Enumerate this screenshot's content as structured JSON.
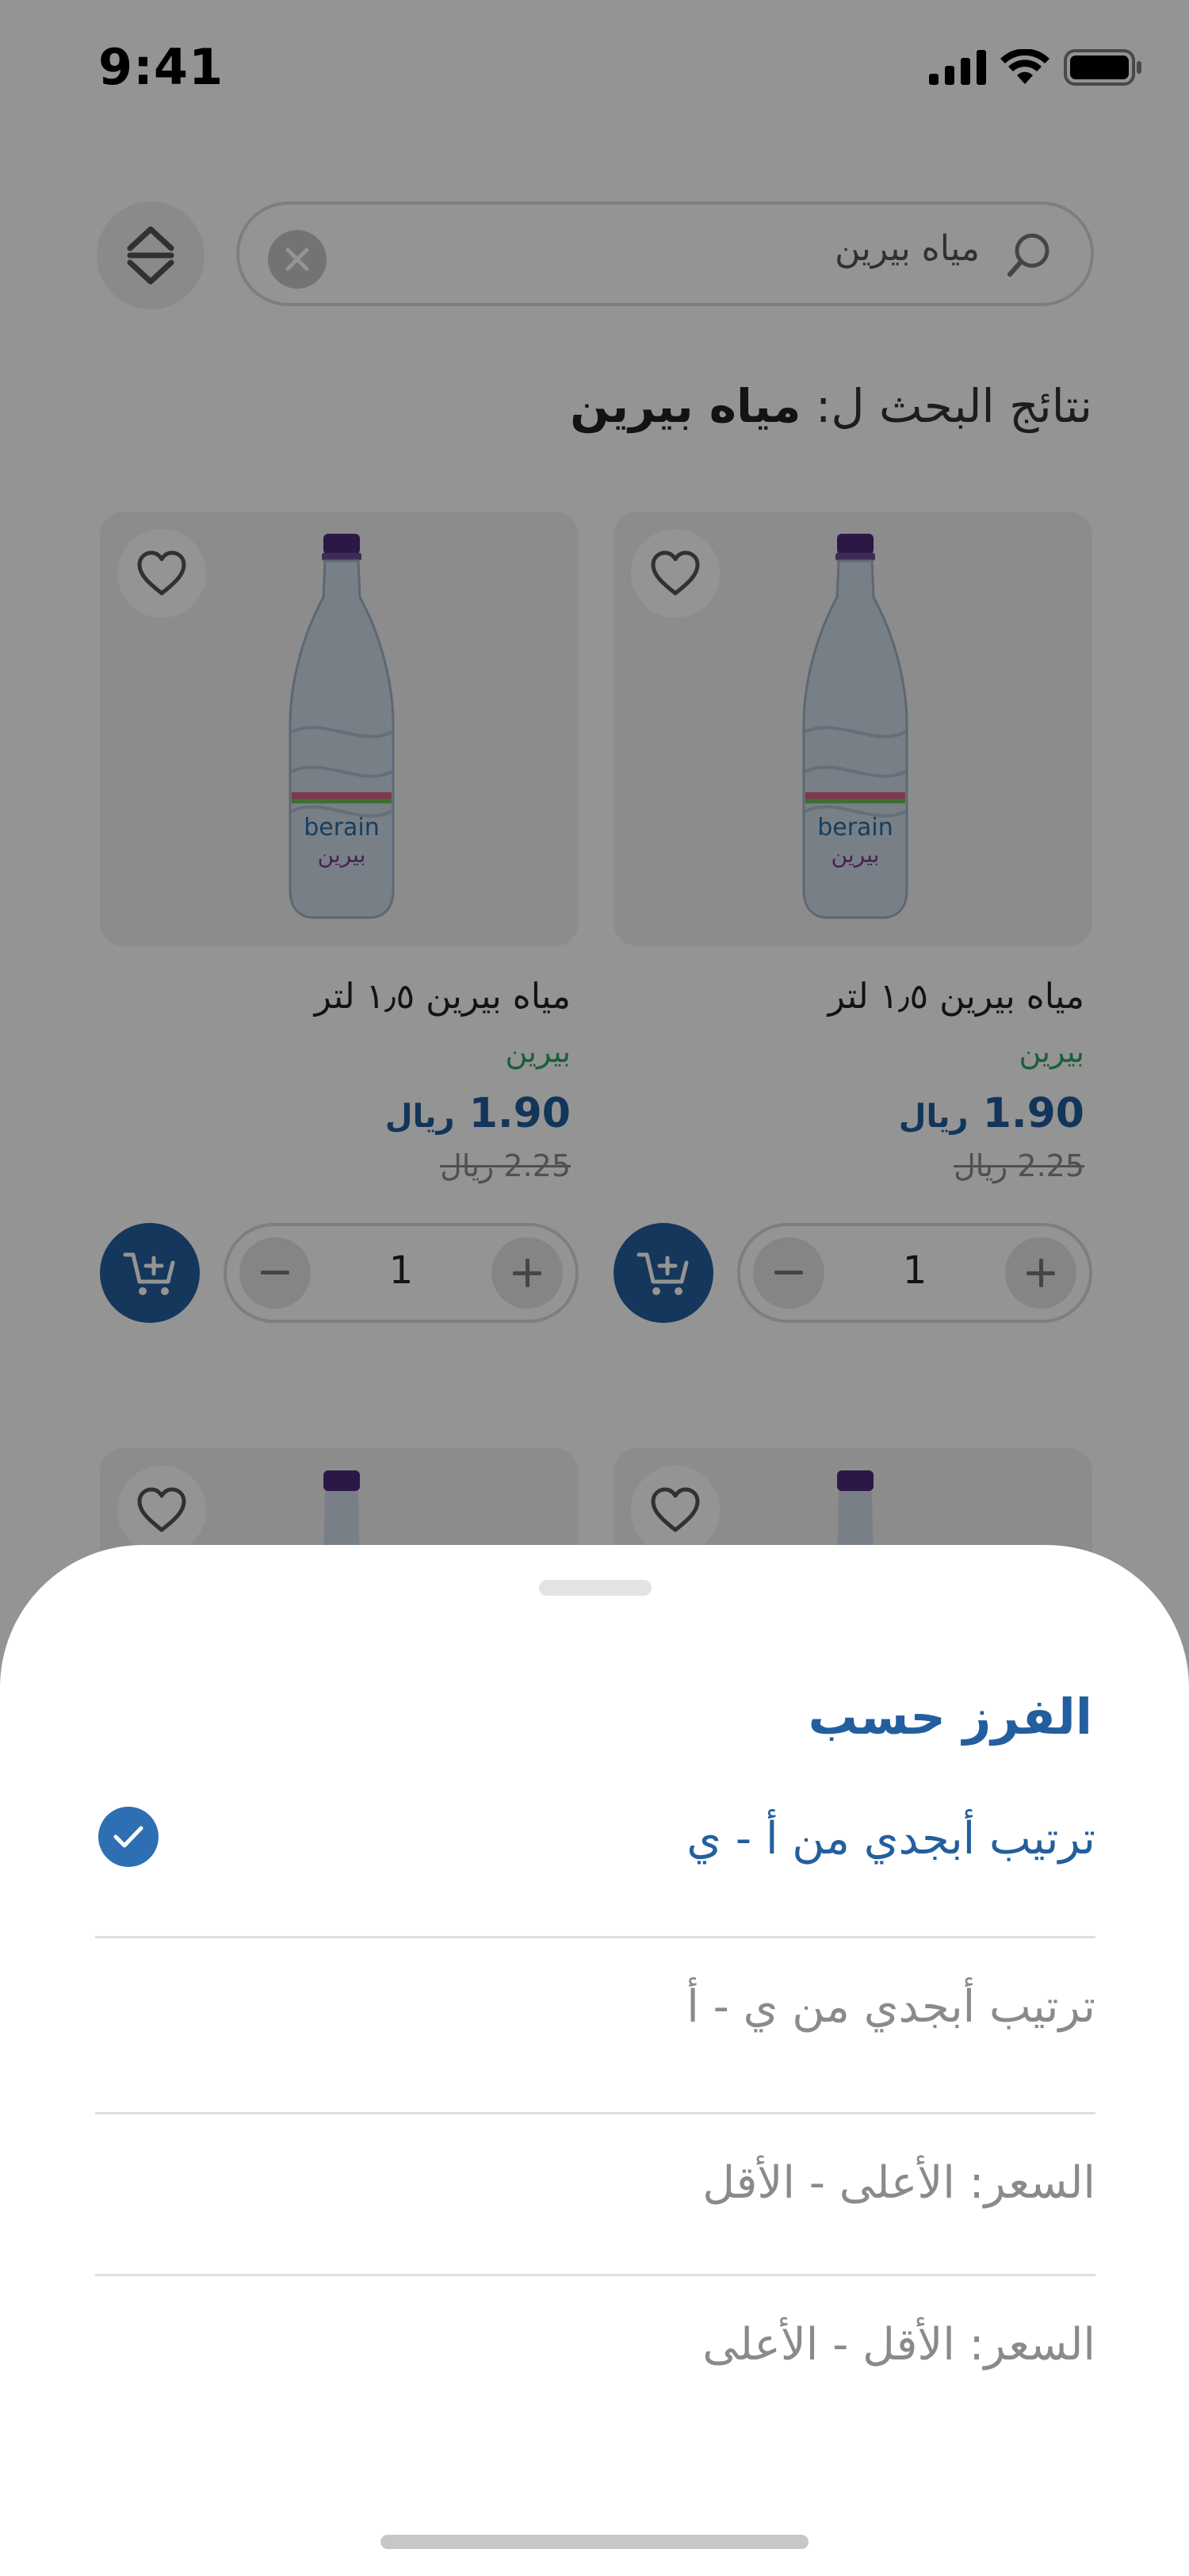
{
  "status_bar": {
    "time": "9:41"
  },
  "search": {
    "query": "مياه بيرين"
  },
  "results": {
    "prefix": "نتائج البحث ل:",
    "query": "مياه بيرين"
  },
  "products": [
    {
      "name": "مياه بيرين ١٫٥ لتر",
      "brand": "بيرين",
      "price": "1.90",
      "currency": "ريال",
      "old_price": "2.25",
      "old_currency": "ريال",
      "quantity": "1"
    },
    {
      "name": "مياه بيرين ١٫٥ لتر",
      "brand": "بيرين",
      "price": "1.90",
      "currency": "ريال",
      "old_price": "2.25",
      "old_currency": "ريال",
      "quantity": "1"
    }
  ],
  "sort_sheet": {
    "title": "الفرز حسب",
    "options": [
      {
        "label": "ترتيب أبجدي من أ - ي",
        "selected": true
      },
      {
        "label": "ترتيب أبجدي من ي - أ",
        "selected": false
      },
      {
        "label": "السعر: الأعلى - الأقل",
        "selected": false
      },
      {
        "label": "السعر: الأقل - الأعلى",
        "selected": false
      }
    ]
  },
  "colors": {
    "primary": "#235f9e",
    "brand_green": "#2aa566",
    "muted": "#8a8a8a"
  }
}
